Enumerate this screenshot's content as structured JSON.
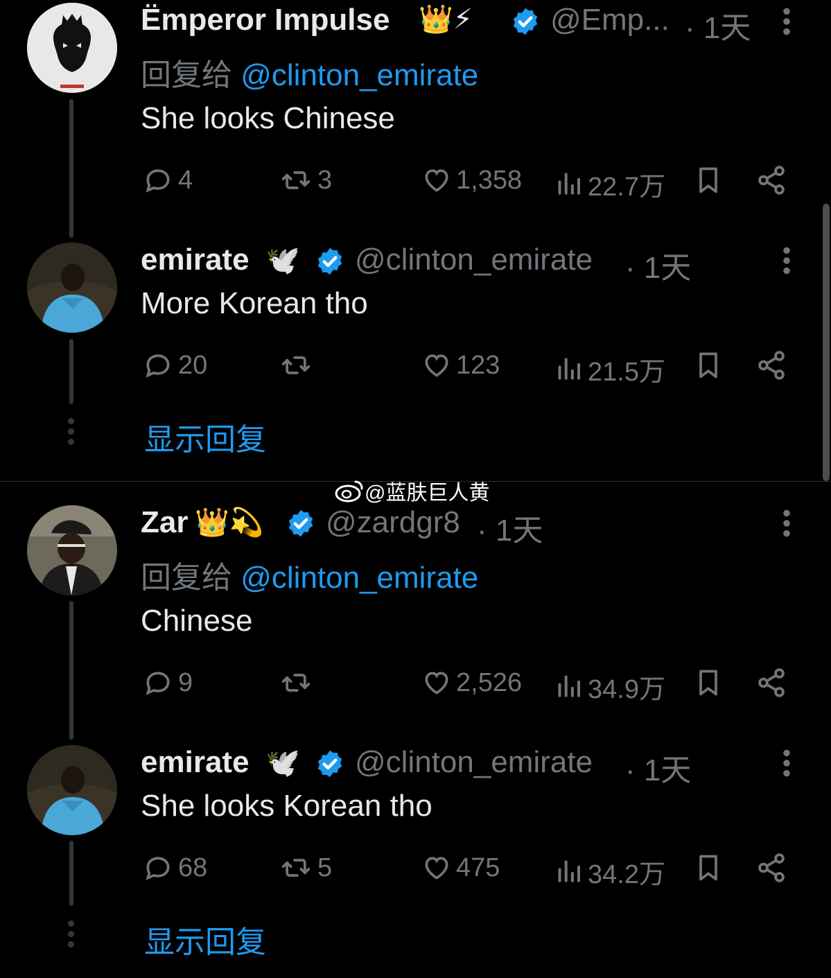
{
  "colors": {
    "background": "#000000",
    "text": "#e7e9ea",
    "muted": "#71767b",
    "accent": "#1d9bf0",
    "line": "#333639"
  },
  "tweets": [
    {
      "name": "Ëmperor Impulse",
      "emoji": "👑⚡",
      "handle": "@Emp...",
      "time": "· 1天",
      "reply_prefix": "回复给",
      "reply_to": "@clinton_emirate",
      "text": "She looks Chinese",
      "replies": "4",
      "retweets": "3",
      "likes": "1,358",
      "views": "22.7万",
      "avatar_icon": "lion-logo-icon"
    },
    {
      "name": "emirate",
      "emoji": "🕊️",
      "handle": "@clinton_emirate",
      "time": "· 1天",
      "text": "More Korean tho",
      "replies": "20",
      "retweets": "",
      "likes": "123",
      "views": "21.5万",
      "avatar_icon": "person-avatar-icon"
    },
    {
      "name": "Zar",
      "emoji": "👑💫",
      "handle": "@zardgr8",
      "time": "· 1天",
      "reply_prefix": "回复给",
      "reply_to": "@clinton_emirate",
      "text": "Chinese",
      "replies": "9",
      "retweets": "",
      "likes": "2,526",
      "views": "34.9万",
      "avatar_icon": "person-avatar-icon"
    },
    {
      "name": "emirate",
      "emoji": "🕊️",
      "handle": "@clinton_emirate",
      "time": "· 1天",
      "text": "She looks Korean tho",
      "replies": "68",
      "retweets": "5",
      "likes": "475",
      "views": "34.2万",
      "avatar_icon": "person-avatar-icon"
    }
  ],
  "show_replies_label": "显示回复",
  "watermark": "@蓝肤巨人黄"
}
